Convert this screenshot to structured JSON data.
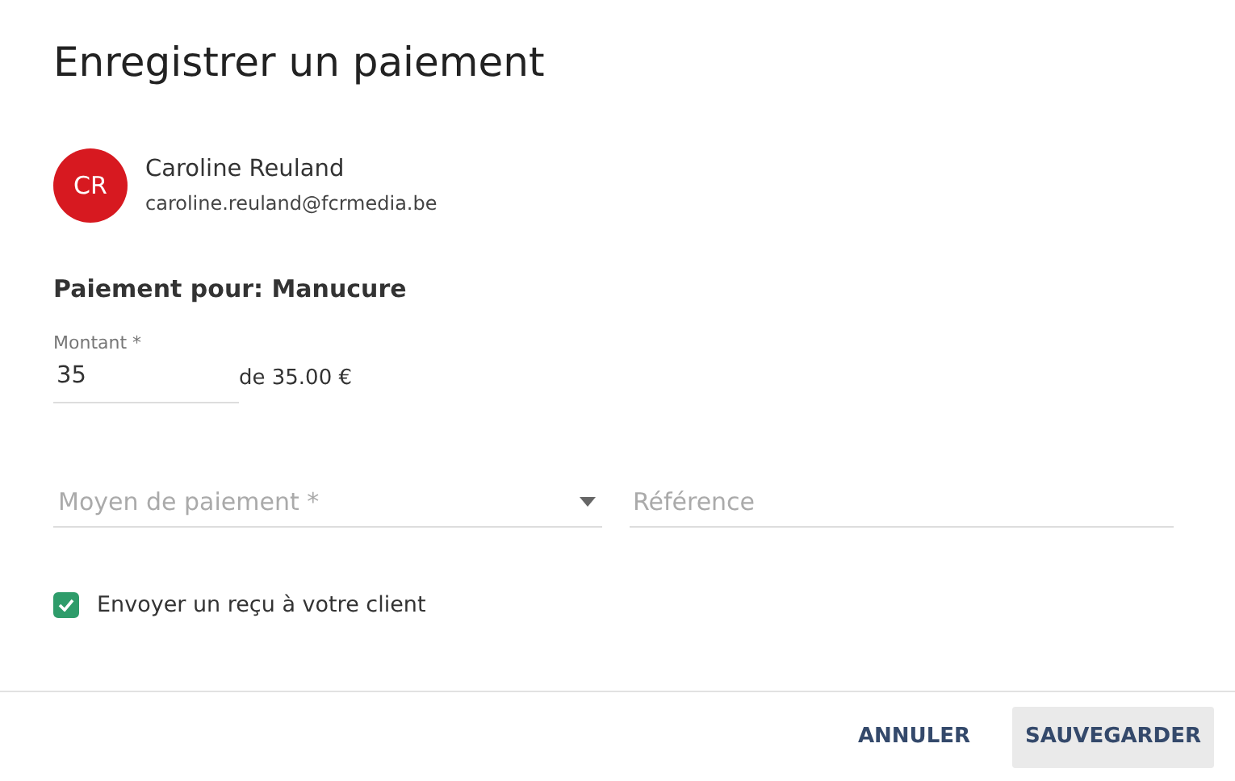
{
  "dialog": {
    "title": "Enregistrer un paiement"
  },
  "client": {
    "initials": "CR",
    "name": "Caroline Reuland",
    "email": "caroline.reuland@fcrmedia.be"
  },
  "payment_for": "Paiement pour: Manucure",
  "amount": {
    "label": "Montant *",
    "value": "35",
    "total": "de 35.00 €"
  },
  "method": {
    "placeholder": "Moyen de paiement *"
  },
  "reference": {
    "placeholder": "Référence"
  },
  "receipt": {
    "label": "Envoyer un reçu à votre client",
    "checked": true
  },
  "buttons": [
    {
      "kind": "text",
      "label": "ANNULER"
    },
    {
      "kind": "filled",
      "label": "SAUVEGARDER"
    }
  ]
}
